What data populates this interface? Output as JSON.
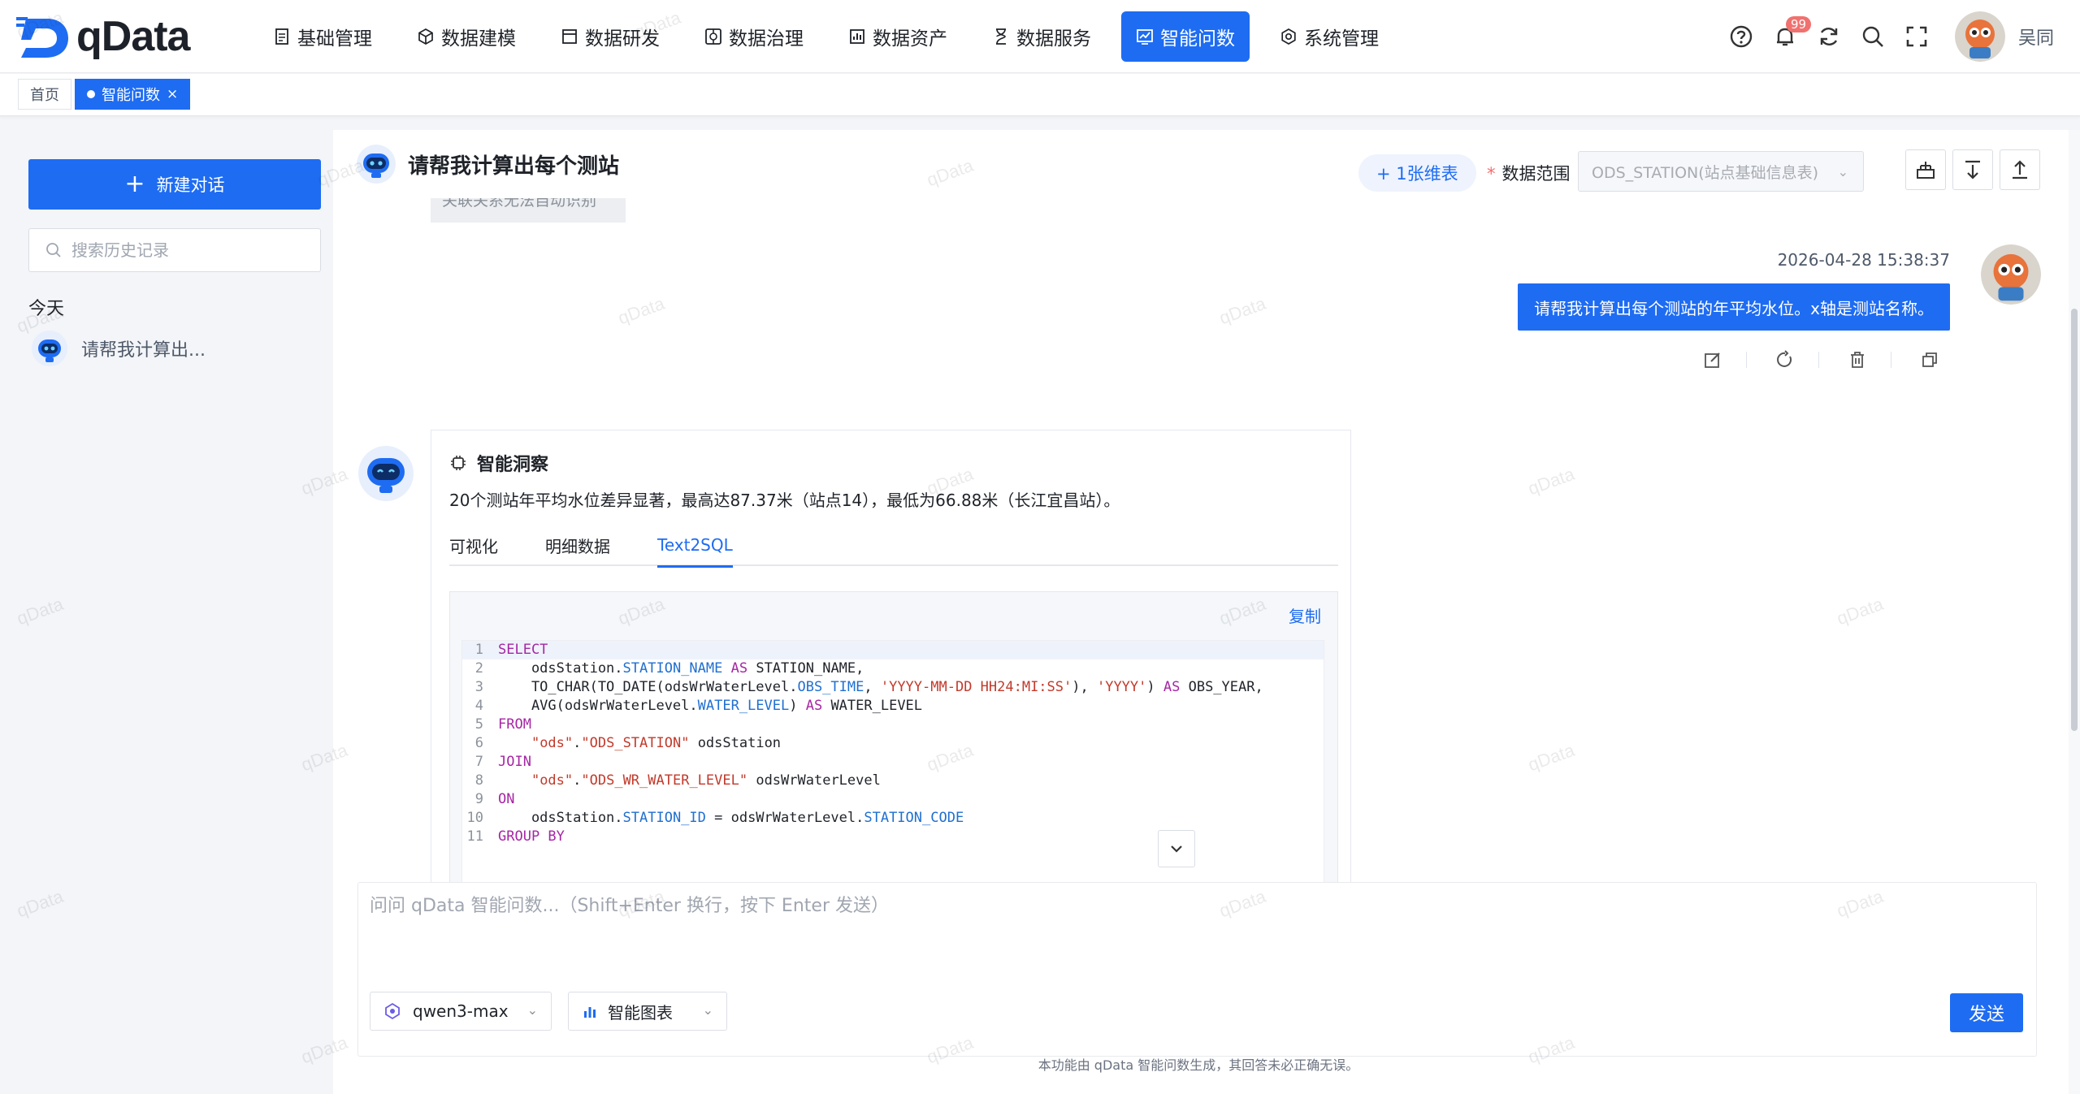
{
  "app": {
    "logo_text": "qData",
    "user_name": "吴同",
    "notification_count": "99"
  },
  "nav": [
    {
      "label": "基础管理",
      "icon": "document-icon"
    },
    {
      "label": "数据建模",
      "icon": "cube-icon"
    },
    {
      "label": "数据研发",
      "icon": "window-icon"
    },
    {
      "label": "数据治理",
      "icon": "govern-icon"
    },
    {
      "label": "数据资产",
      "icon": "asset-icon"
    },
    {
      "label": "数据服务",
      "icon": "hourglass-icon"
    },
    {
      "label": "智能问数",
      "icon": "chart-screen-icon",
      "active": true
    },
    {
      "label": "系统管理",
      "icon": "gear-icon"
    }
  ],
  "tabs": [
    {
      "label": "首页",
      "active": false
    },
    {
      "label": "智能问数",
      "active": true,
      "close": "×"
    }
  ],
  "sidebar": {
    "new_chat_label": "新建对话",
    "search_placeholder": "搜索历史记录",
    "group_today": "今天",
    "history": [
      {
        "title": "请帮我计算出..."
      }
    ]
  },
  "chat": {
    "title": "请帮我计算出每个测站",
    "dim_table_button": "+ 1张维表",
    "scope_label": "数据范围",
    "scope_value": "ODS_STATION(站点基础信息表)",
    "faded_text": "关联关系无法自动识别",
    "user_message": {
      "time": "2026-04-28 15:38:37",
      "text": "请帮我计算出每个测站的年平均水位。x轴是测站名称。"
    },
    "answer": {
      "insight_title": "智能洞察",
      "insight_text": "20个测站年平均水位差异显著，最高达87.37米（站点14），最低为66.88米（长江宜昌站）。",
      "tabs": [
        {
          "label": "可视化",
          "active": false
        },
        {
          "label": "明细数据",
          "active": false
        },
        {
          "label": "Text2SQL",
          "active": true
        }
      ],
      "copy_label": "复制",
      "sql_lines": [
        {
          "n": "1",
          "tokens": [
            {
              "t": "SELECT",
              "c": "kw"
            }
          ]
        },
        {
          "n": "2",
          "tokens": [
            {
              "t": "    odsStation.",
              "c": "pl"
            },
            {
              "t": "STATION_NAME",
              "c": "fld"
            },
            {
              "t": " ",
              "c": "pl"
            },
            {
              "t": "AS",
              "c": "kw"
            },
            {
              "t": " STATION_NAME,",
              "c": "pl"
            }
          ]
        },
        {
          "n": "3",
          "tokens": [
            {
              "t": "    TO_CHAR(TO_DATE(odsWrWaterLevel.",
              "c": "pl"
            },
            {
              "t": "OBS_TIME",
              "c": "fld"
            },
            {
              "t": ", ",
              "c": "pl"
            },
            {
              "t": "'YYYY-MM-DD HH24:MI:SS'",
              "c": "str"
            },
            {
              "t": "), ",
              "c": "pl"
            },
            {
              "t": "'YYYY'",
              "c": "str"
            },
            {
              "t": ") ",
              "c": "pl"
            },
            {
              "t": "AS",
              "c": "kw"
            },
            {
              "t": " OBS_YEAR,",
              "c": "pl"
            }
          ]
        },
        {
          "n": "4",
          "tokens": [
            {
              "t": "    AVG(odsWrWaterLevel.",
              "c": "pl"
            },
            {
              "t": "WATER_LEVEL",
              "c": "fld"
            },
            {
              "t": ") ",
              "c": "pl"
            },
            {
              "t": "AS",
              "c": "kw"
            },
            {
              "t": " WATER_LEVEL",
              "c": "pl"
            }
          ]
        },
        {
          "n": "5",
          "tokens": [
            {
              "t": "FROM",
              "c": "kw"
            }
          ]
        },
        {
          "n": "6",
          "tokens": [
            {
              "t": "    ",
              "c": "pl"
            },
            {
              "t": "\"ods\"",
              "c": "str"
            },
            {
              "t": ".",
              "c": "pl"
            },
            {
              "t": "\"ODS_STATION\"",
              "c": "str"
            },
            {
              "t": " odsStation",
              "c": "pl"
            }
          ]
        },
        {
          "n": "7",
          "tokens": [
            {
              "t": "JOIN",
              "c": "kw"
            }
          ]
        },
        {
          "n": "8",
          "tokens": [
            {
              "t": "    ",
              "c": "pl"
            },
            {
              "t": "\"ods\"",
              "c": "str"
            },
            {
              "t": ".",
              "c": "pl"
            },
            {
              "t": "\"ODS_WR_WATER_LEVEL\"",
              "c": "str"
            },
            {
              "t": " odsWrWaterLevel",
              "c": "pl"
            }
          ]
        },
        {
          "n": "9",
          "tokens": [
            {
              "t": "ON",
              "c": "kw"
            }
          ]
        },
        {
          "n": "10",
          "tokens": [
            {
              "t": "    odsStation.",
              "c": "pl"
            },
            {
              "t": "STATION_ID",
              "c": "fld"
            },
            {
              "t": " = odsWrWaterLevel.",
              "c": "pl"
            },
            {
              "t": "STATION_CODE",
              "c": "fld"
            }
          ]
        },
        {
          "n": "11",
          "tokens": [
            {
              "t": "GROUP BY",
              "c": "kw"
            }
          ]
        }
      ]
    }
  },
  "composer": {
    "placeholder": "问问 qData 智能问数...（Shift+Enter 换行，按下 Enter 发送）",
    "model": "qwen3-max",
    "mode": "智能图表",
    "send_label": "发送",
    "disclaimer": "本功能由 qData 智能问数生成，其回答未必正确无误。"
  },
  "watermark": "qData",
  "colors": {
    "primary": "#1e6cf2",
    "keyword": "#a626a4",
    "field": "#1f6fd0",
    "string": "#c23a2b"
  }
}
